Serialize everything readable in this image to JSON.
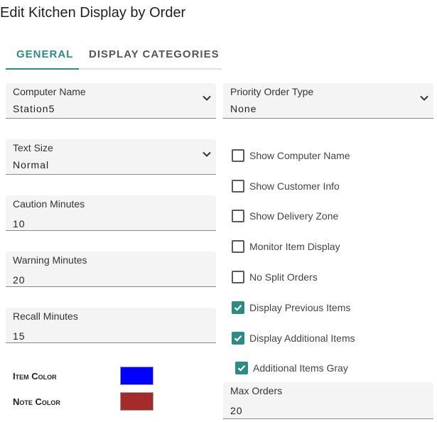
{
  "page": {
    "title": "Edit Kitchen Display by Order"
  },
  "tabs": [
    {
      "label": "GENERAL",
      "active": true
    },
    {
      "label": "DISPLAY CATEGORIES",
      "active": false
    }
  ],
  "fields": {
    "computer_name": {
      "label": "Computer Name",
      "value": "Station5"
    },
    "priority_order_type": {
      "label": "Priority Order Type",
      "value": "None"
    },
    "text_size": {
      "label": "Text Size",
      "value": "Normal"
    },
    "caution_minutes": {
      "label": "Caution Minutes",
      "value": "10"
    },
    "warning_minutes": {
      "label": "Warning Minutes",
      "value": "20"
    },
    "recall_minutes": {
      "label": "Recall Minutes",
      "value": "15"
    },
    "max_orders": {
      "label": "Max Orders",
      "value": "20"
    }
  },
  "checkboxes": [
    {
      "label": "Show Computer Name",
      "checked": false
    },
    {
      "label": "Show Customer Info",
      "checked": false
    },
    {
      "label": "Show Delivery Zone",
      "checked": false
    },
    {
      "label": "Monitor Item Display",
      "checked": false
    },
    {
      "label": "No Split Orders",
      "checked": false
    },
    {
      "label": "Display Previous Items",
      "checked": true
    },
    {
      "label": "Display Additional Items",
      "checked": true
    },
    {
      "label": "Additional Items Gray",
      "checked": true
    }
  ],
  "colors": {
    "item": {
      "label": "Item Color",
      "value": "#0000ff"
    },
    "note": {
      "label": "Note Color",
      "value": "#a52a2a"
    }
  },
  "theme": {
    "accent": "#2a8c82"
  },
  "icons": {
    "dropdown": "chevron-down-icon",
    "check": "check-icon"
  }
}
